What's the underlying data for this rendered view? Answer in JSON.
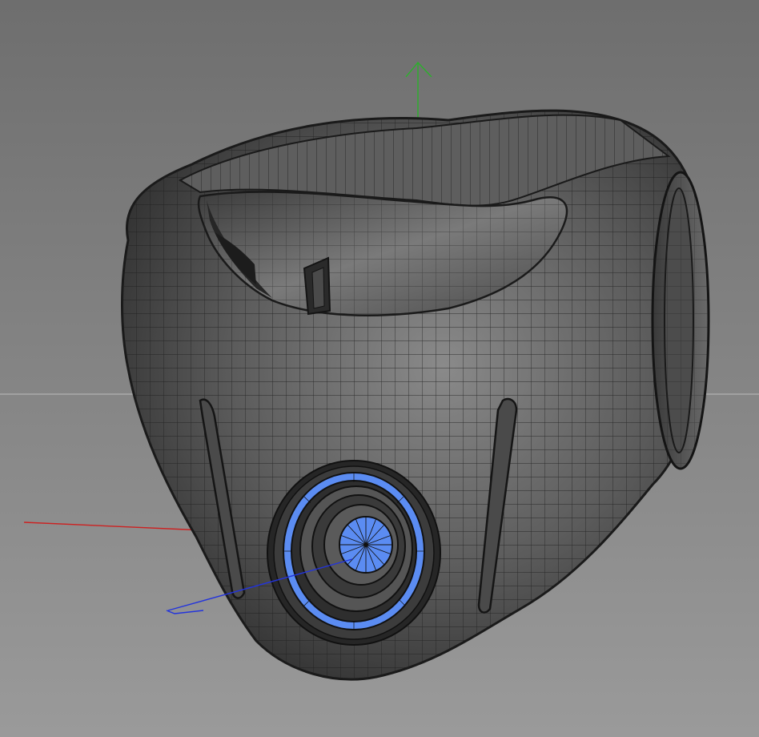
{
  "viewport": {
    "background_top": "#6e6e6e",
    "background_bottom": "#9a9a9a",
    "horizon_color": "#bdbdbd"
  },
  "axes": {
    "x_color": "#cc2222",
    "y_color": "#2bb02b",
    "z_color": "#2233dd"
  },
  "model": {
    "name": "mask",
    "wire_color": "#1e1e1e",
    "shade_light": "#8a8a8a",
    "shade_dark": "#2c2c2c",
    "selection_color": "#5b8cf2"
  }
}
